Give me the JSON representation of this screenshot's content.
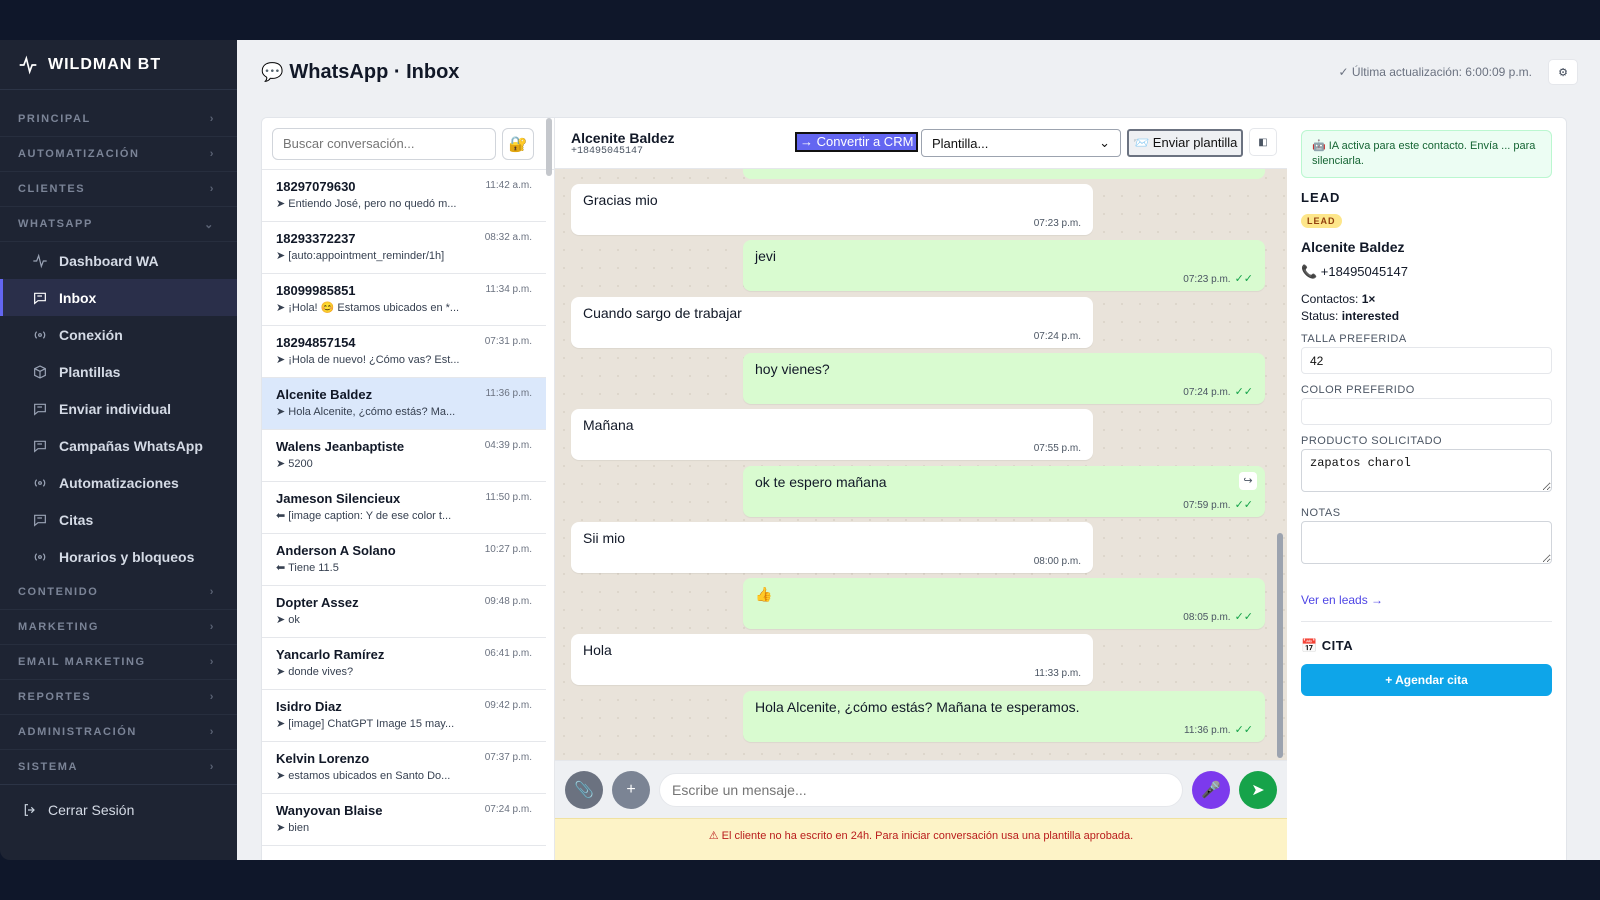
{
  "brand": {
    "name": "WILDMAN BT"
  },
  "sidebar": {
    "sections_top": [
      "PRINCIPAL",
      "AUTOMATIZACIÓN",
      "CLIENTES"
    ],
    "whatsapp_section": "WHATSAPP",
    "items": [
      {
        "label": "Dashboard WA",
        "icon": "activity-icon"
      },
      {
        "label": "Inbox",
        "icon": "message-icon",
        "active": true
      },
      {
        "label": "Conexión",
        "icon": "radio-icon"
      },
      {
        "label": "Plantillas",
        "icon": "box-icon"
      },
      {
        "label": "Enviar individual",
        "icon": "message-icon"
      },
      {
        "label": "Campañas WhatsApp",
        "icon": "message-icon"
      },
      {
        "label": "Automatizaciones",
        "icon": "radio-icon"
      },
      {
        "label": "Citas",
        "icon": "message-icon"
      },
      {
        "label": "Horarios y bloqueos",
        "icon": "radio-icon"
      }
    ],
    "sections_bottom": [
      "CONTENIDO",
      "MARKETING",
      "EMAIL MARKETING",
      "REPORTES",
      "ADMINISTRACIÓN",
      "SISTEMA"
    ],
    "logout": "Cerrar Sesión"
  },
  "header": {
    "title": "WhatsApp · Inbox",
    "title_icon": "💬",
    "last_update": "✓ Última actualización: 6:00:09 p.m.",
    "settings_icon": "⚙"
  },
  "conversations": {
    "search_placeholder": "Buscar conversación...",
    "lock_icon": "🔐",
    "items": [
      {
        "name": "18297079630",
        "time": "11:42 a.m.",
        "preview": "➤ Entiendo José, pero no quedó m..."
      },
      {
        "name": "18293372237",
        "time": "08:32 a.m.",
        "preview": "➤ [auto:appointment_reminder/1h]"
      },
      {
        "name": "18099985851",
        "time": "11:34 p.m.",
        "preview": "➤ ¡Hola! 😊 Estamos ubicados en *..."
      },
      {
        "name": "18294857154",
        "time": "07:31 p.m.",
        "preview": "➤ ¡Hola de nuevo! ¿Cómo vas? Est..."
      },
      {
        "name": "Alcenite Baldez",
        "time": "11:36 p.m.",
        "preview": "➤ Hola Alcenite, ¿cómo estás? Ma...",
        "selected": true
      },
      {
        "name": "Walens Jeanbaptiste",
        "time": "04:39 p.m.",
        "preview": "➤ 5200"
      },
      {
        "name": "Jameson Silencieux",
        "time": "11:50 p.m.",
        "preview": "⬅ [image caption: Y de ese color t..."
      },
      {
        "name": "Anderson A Solano",
        "time": "10:27 p.m.",
        "preview": "⬅ Tiene 11.5"
      },
      {
        "name": "Dopter Assez",
        "time": "09:48 p.m.",
        "preview": "➤ ok"
      },
      {
        "name": "Yancarlo Ramírez",
        "time": "06:41 p.m.",
        "preview": "➤ donde vives?"
      },
      {
        "name": "Isidro Diaz",
        "time": "09:42 p.m.",
        "preview": "➤ [image] ChatGPT Image 15 may..."
      },
      {
        "name": "Kelvin Lorenzo",
        "time": "07:37 p.m.",
        "preview": "➤ estamos ubicados en Santo Do..."
      },
      {
        "name": "Wanyovan Blaise",
        "time": "07:24 p.m.",
        "preview": "➤ bien"
      }
    ]
  },
  "chat": {
    "contact_name": "Alcenite Baldez",
    "contact_phone": "+18495045147",
    "convert_btn": "→ Convertir a CRM",
    "template_select": "Plantilla...",
    "send_template_btn": "📨 Enviar plantilla",
    "panel_toggle_icon": "◧",
    "messages": [
      {
        "dir": "in",
        "text": "Gracias mio",
        "time": "07:23 p.m."
      },
      {
        "dir": "out",
        "text": "jevi",
        "time": "07:23 p.m.",
        "ticks": "✓✓"
      },
      {
        "dir": "in",
        "text": "Cuando sargo de trabajar",
        "time": "07:24 p.m."
      },
      {
        "dir": "out",
        "text": "hoy vienes?",
        "time": "07:24 p.m.",
        "ticks": "✓✓"
      },
      {
        "dir": "in",
        "text": "Mañana",
        "time": "07:55 p.m."
      },
      {
        "dir": "out",
        "text": "ok te espero mañana",
        "time": "07:59 p.m.",
        "ticks": "✓✓",
        "forward_icon": "↪"
      },
      {
        "dir": "in",
        "text": "Sii mio",
        "time": "08:00 p.m."
      },
      {
        "dir": "out",
        "text": "👍",
        "time": "08:05 p.m.",
        "ticks": "✓✓"
      },
      {
        "dir": "in",
        "text": "Hola",
        "time": "11:33 p.m."
      },
      {
        "dir": "out",
        "text": "Hola Alcenite, ¿cómo estás? Mañana te esperamos.",
        "time": "11:36 p.m.",
        "ticks": "✓✓"
      }
    ],
    "composer": {
      "attach_icon": "📎",
      "plus_icon": "+",
      "placeholder": "Escribe un mensaje...",
      "mic_icon": "🎤",
      "send_icon": "➤"
    },
    "warning": "⚠ El cliente no ha escrito en 24h. Para iniciar conversación usa una plantilla aprobada."
  },
  "lead": {
    "ai_notice": "🤖 IA activa para este contacto. Envía ... para silenciarla.",
    "heading": "LEAD",
    "badge": "LEAD",
    "name": "Alcenite Baldez",
    "phone": "📞 +18495045147",
    "contacts_label": "Contactos:",
    "contacts_value": "1×",
    "status_label": "Status:",
    "status_value": "interested",
    "size_label": "TALLA PREFERIDA",
    "size_value": "42",
    "color_label": "COLOR PREFERIDO",
    "color_value": "",
    "product_label": "PRODUCTO SOLICITADO",
    "product_value": "zapatos charol",
    "notes_label": "NOTAS",
    "notes_value": "",
    "leads_link": "Ver en leads →",
    "cita_heading": "📅 CITA",
    "cita_btn": "+ Agendar cita"
  }
}
